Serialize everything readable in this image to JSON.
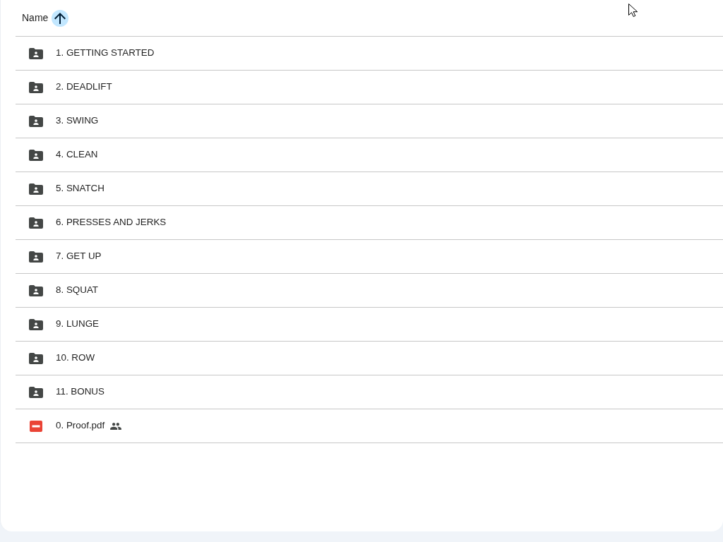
{
  "table": {
    "columns": [
      {
        "label": "Name",
        "sort_ascending": true
      }
    ],
    "rows": [
      {
        "kind": "folder",
        "name": "1. GETTING STARTED",
        "shared": true
      },
      {
        "kind": "folder",
        "name": "2. DEADLIFT",
        "shared": true
      },
      {
        "kind": "folder",
        "name": "3. SWING",
        "shared": true
      },
      {
        "kind": "folder",
        "name": "4. CLEAN",
        "shared": true
      },
      {
        "kind": "folder",
        "name": "5. SNATCH",
        "shared": true
      },
      {
        "kind": "folder",
        "name": "6. PRESSES AND JERKS",
        "shared": true
      },
      {
        "kind": "folder",
        "name": "7. GET UP",
        "shared": true
      },
      {
        "kind": "folder",
        "name": "8. SQUAT",
        "shared": true
      },
      {
        "kind": "folder",
        "name": "9. LUNGE",
        "shared": true
      },
      {
        "kind": "folder",
        "name": "10. ROW",
        "shared": true
      },
      {
        "kind": "folder",
        "name": "11. BONUS",
        "shared": true
      },
      {
        "kind": "pdf",
        "name": "0. Proof.pdf",
        "shared": true
      }
    ]
  }
}
